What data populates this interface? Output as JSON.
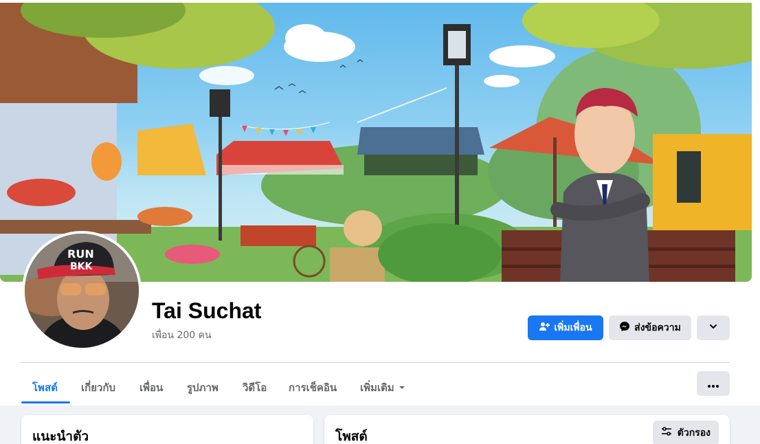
{
  "profile": {
    "name": "Tai Suchat",
    "friends_text": "เพื่อน 200 คน"
  },
  "actions": {
    "add_friend": "เพิ่มเพื่อน",
    "message": "ส่งข้อความ"
  },
  "tabs": [
    {
      "label": "โพสต์",
      "active": true
    },
    {
      "label": "เกี่ยวกับ",
      "active": false
    },
    {
      "label": "เพื่อน",
      "active": false
    },
    {
      "label": "รูปภาพ",
      "active": false
    },
    {
      "label": "วิดีโอ",
      "active": false
    },
    {
      "label": "การเช็คอิน",
      "active": false
    },
    {
      "label": "เพิ่มเติม",
      "active": false
    }
  ],
  "intro": {
    "title": "แนะนำตัว"
  },
  "posts": {
    "title": "โพสต์",
    "filter_label": "ตัวกรอง"
  },
  "colors": {
    "accent": "#1877f2",
    "button_gray": "#e4e6eb",
    "secondary_text": "#65676b"
  },
  "icons": [
    "add-friend-icon",
    "messenger-icon",
    "chevron-down-icon",
    "more-dots-icon",
    "filter-icon",
    "caret-down-icon"
  ]
}
